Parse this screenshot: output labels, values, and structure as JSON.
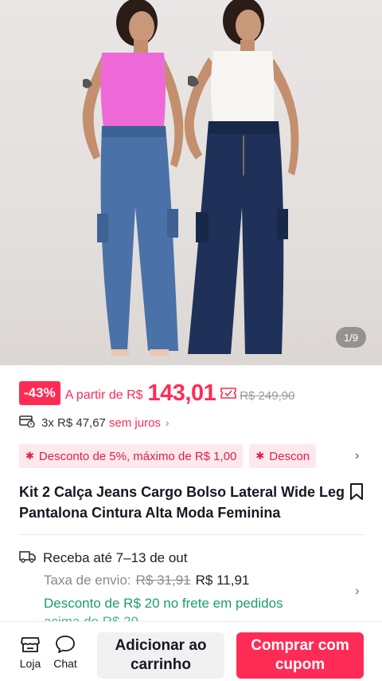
{
  "product_image": {
    "counter": "1/9"
  },
  "price": {
    "discount_badge": "-43%",
    "from_label": "A partir de R$",
    "current": "143,01",
    "original": "R$ 249,90"
  },
  "installments": {
    "text": "3x R$ 47,67",
    "interest": "sem juros"
  },
  "promos": [
    {
      "label": "Desconto de 5%, máximo de R$ 1,00"
    },
    {
      "label": "Descon"
    }
  ],
  "title": "Kit 2 Calça Jeans Cargo Bolso Lateral Wide Leg Pantalona Cintura Alta Moda Feminina",
  "shipping": {
    "delivery": "Receba até 7–13 de out",
    "fee_label": "Taxa de envio:",
    "fee_old": "R$ 31,91",
    "fee_new": "R$ 11,91",
    "discount_line1": "Desconto de R$ 20 no frete em pedidos",
    "discount_line2": "acima de R$ 29"
  },
  "bottom_bar": {
    "store_label": "Loja",
    "chat_label": "Chat",
    "add_to_cart_label": "Adicionar ao carrinho",
    "buy_label": "Comprar com cupom"
  },
  "colors": {
    "accent": "#fe2c55",
    "promo_bg": "#fde8ed",
    "free_shipping": "#1a9e6a"
  }
}
